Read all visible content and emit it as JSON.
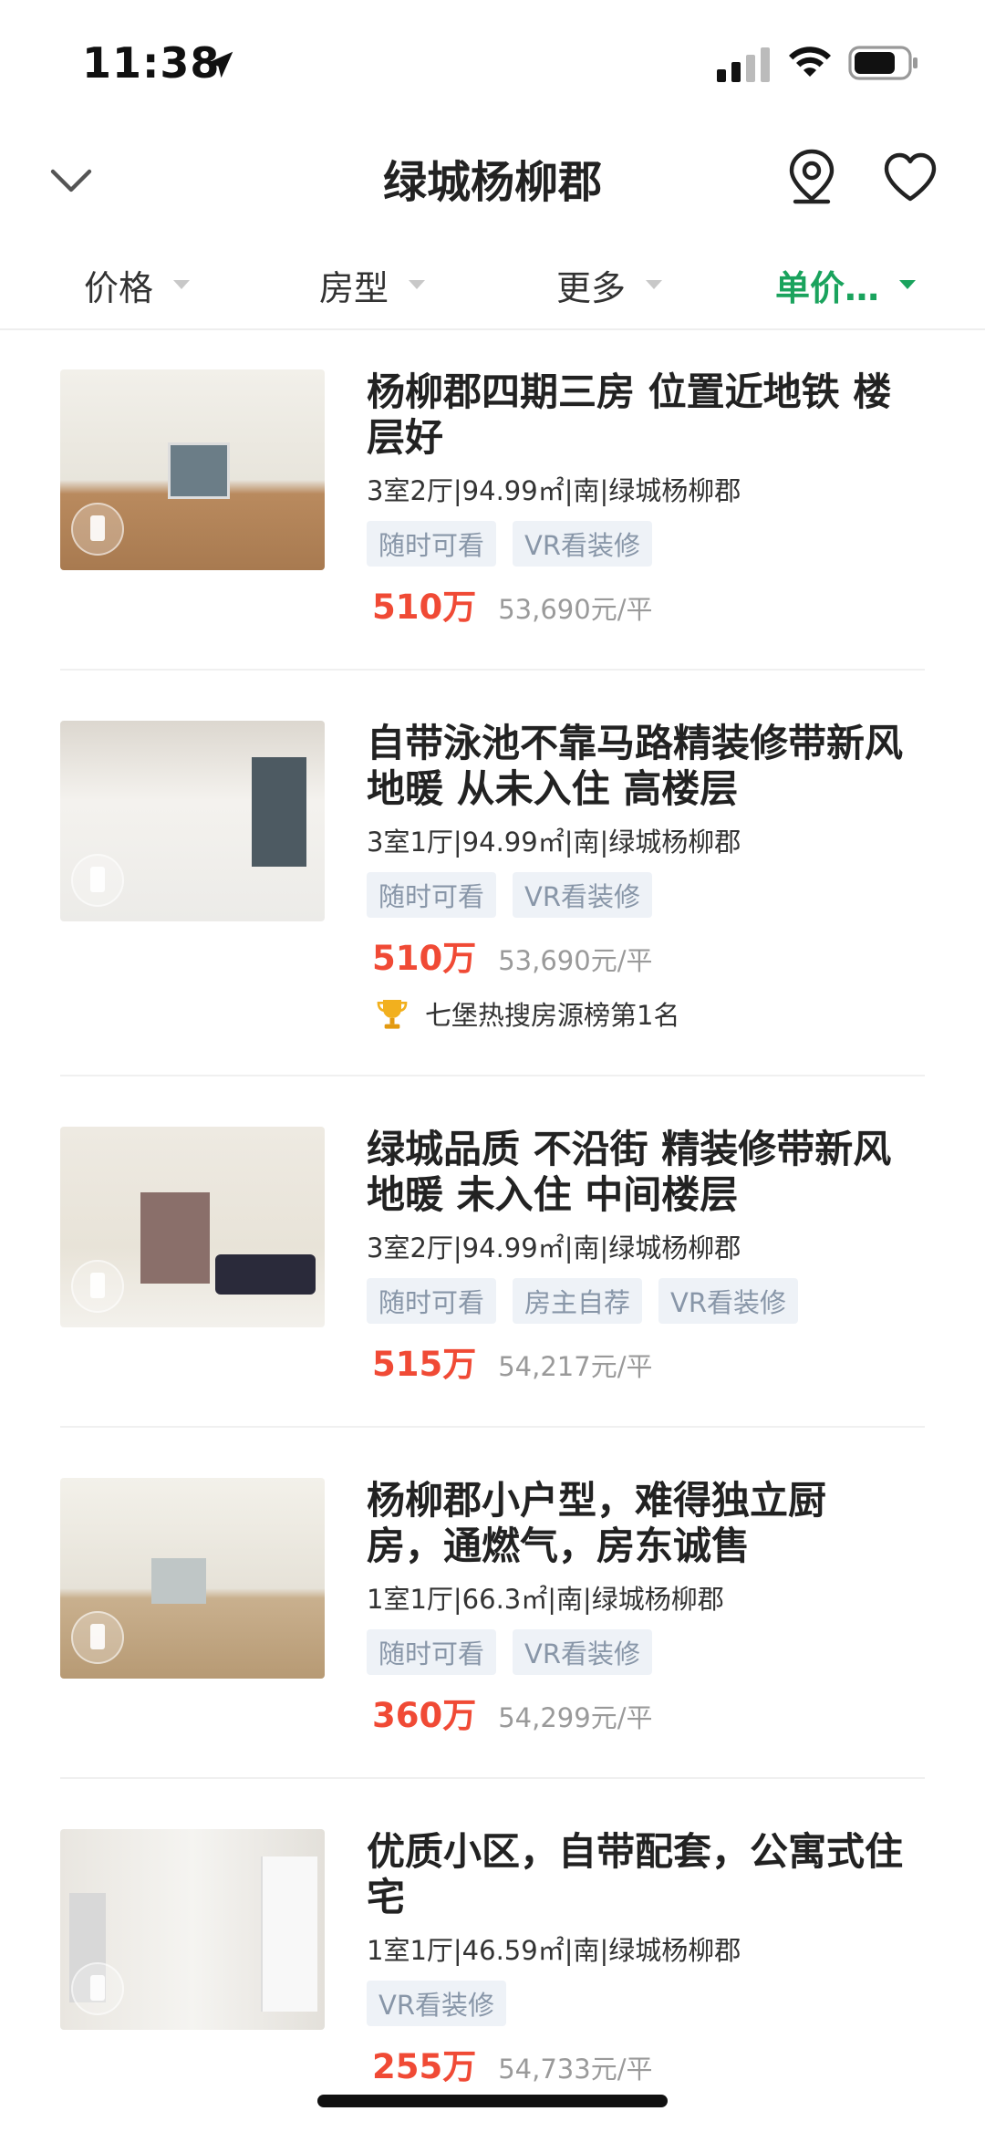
{
  "status_bar": {
    "time": "11:38"
  },
  "header": {
    "title": "绿城杨柳郡",
    "back_icon": "chevron-down-icon",
    "map_icon": "map-pin-icon",
    "favorite_icon": "heart-icon"
  },
  "filters": [
    {
      "label": "价格",
      "active": false
    },
    {
      "label": "房型",
      "active": false
    },
    {
      "label": "更多",
      "active": false
    },
    {
      "label": "单价…",
      "active": true
    }
  ],
  "colors": {
    "accent_green": "#1aa35d",
    "price_red": "#f04a35",
    "tag_bg": "#eef2f7",
    "tag_text": "#8896a8"
  },
  "listings": [
    {
      "title": "杨柳郡四期三房 位置近地铁 楼层好",
      "meta": "3室2厅|94.99㎡|南|绿城杨柳郡",
      "tags": [
        "随时可看",
        "VR看装修"
      ],
      "price": "510万",
      "unit_price": "53,690元/平"
    },
    {
      "title": "自带泳池不靠马路精装修带新风 地暖 从未入住 高楼层",
      "meta": "3室1厅|94.99㎡|南|绿城杨柳郡",
      "tags": [
        "随时可看",
        "VR看装修"
      ],
      "price": "510万",
      "unit_price": "53,690元/平",
      "rank": "七堡热搜房源榜第1名"
    },
    {
      "title": "绿城品质 不沿街 精装修带新风 地暖 未入住 中间楼层",
      "meta": "3室2厅|94.99㎡|南|绿城杨柳郡",
      "tags": [
        "随时可看",
        "房主自荐",
        "VR看装修"
      ],
      "price": "515万",
      "unit_price": "54,217元/平"
    },
    {
      "title": "杨柳郡小户型，难得独立厨房，通燃气，房东诚售",
      "meta": "1室1厅|66.3㎡|南|绿城杨柳郡",
      "tags": [
        "随时可看",
        "VR看装修"
      ],
      "price": "360万",
      "unit_price": "54,299元/平"
    },
    {
      "title": "优质小区，自带配套，公寓式住宅",
      "meta": "1室1厅|46.59㎡|南|绿城杨柳郡",
      "tags": [
        "VR看装修"
      ],
      "price": "255万",
      "unit_price": "54,733元/平"
    }
  ]
}
